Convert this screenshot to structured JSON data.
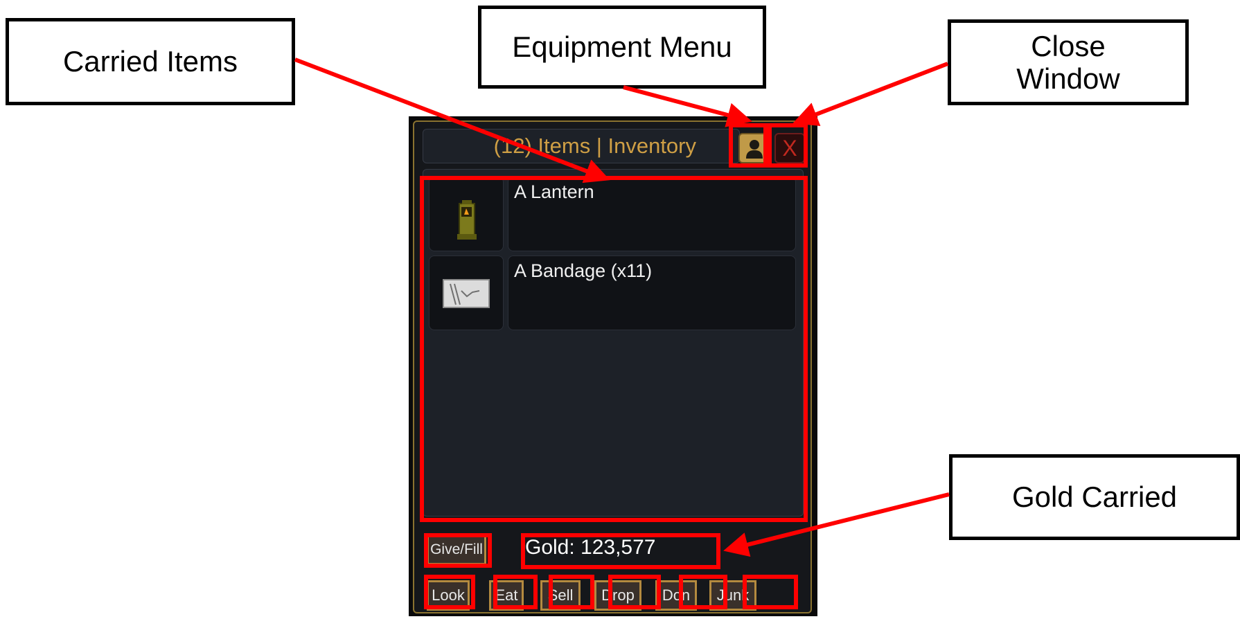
{
  "callouts": {
    "carried_items": "Carried Items",
    "equipment_menu": "Equipment Menu",
    "close_window": "Close\nWindow",
    "gold_carried": "Gold Carried"
  },
  "window": {
    "title": "(12) Items | Inventory",
    "close_label": "X"
  },
  "items": [
    {
      "name": "A Lantern",
      "icon": "lantern-icon"
    },
    {
      "name": "A Bandage (x11)",
      "icon": "bandage-icon"
    }
  ],
  "gold": "Gold: 123,577",
  "buttons": {
    "give_fill": "Give/Fill",
    "look": "Look",
    "eat": "Eat",
    "sell": "Sell",
    "drop": "Drop",
    "don": "Don",
    "junk": "Junk"
  },
  "colors": {
    "annotation": "#ff0000",
    "title_gold": "#cf9f45",
    "button_border": "#b48a3f"
  }
}
